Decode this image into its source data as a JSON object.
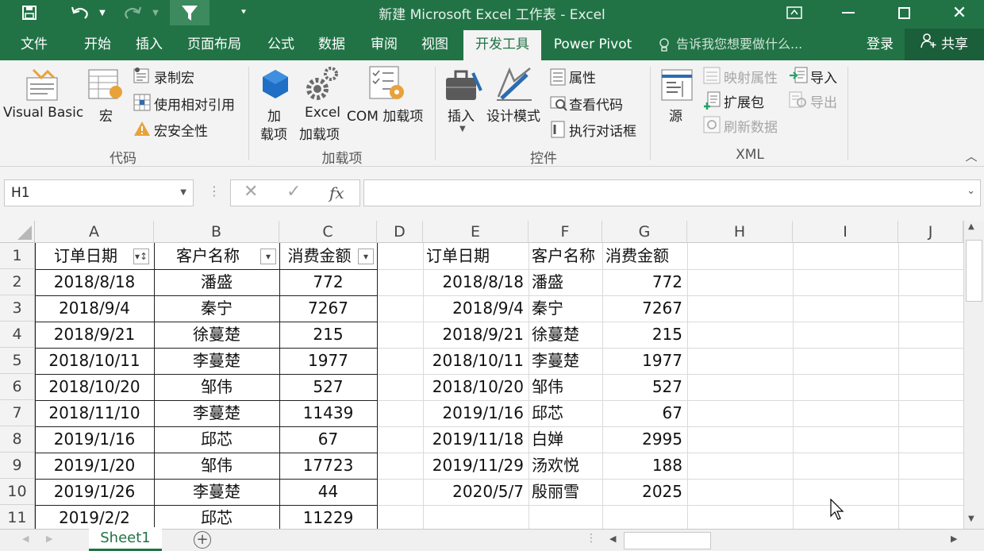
{
  "window": {
    "title": "新建 Microsoft Excel 工作表 - Excel"
  },
  "tabs": [
    "文件",
    "开始",
    "插入",
    "页面布局",
    "公式",
    "数据",
    "审阅",
    "视图",
    "开发工具",
    "Power Pivot"
  ],
  "active_tab": "开发工具",
  "tell_me": "告诉我您想要做什么...",
  "login": "登录",
  "share": "共享",
  "ribbon": {
    "code": {
      "visual_basic": "Visual Basic",
      "macros": "宏",
      "record_macro": "录制宏",
      "relative_ref": "使用相对引用",
      "macro_security": "宏安全性",
      "group": "代码"
    },
    "addins": {
      "addins_line1": "加",
      "addins_line2": "载项",
      "excel_line1": "Excel",
      "excel_line2": "加载项",
      "com": "COM 加载项",
      "group": "加载项"
    },
    "controls": {
      "insert": "插入",
      "design_mode": "设计模式",
      "properties": "属性",
      "view_code": "查看代码",
      "run_dialog": "执行对话框",
      "group": "控件"
    },
    "xml": {
      "source": "源",
      "map_props": "映射属性",
      "expansion": "扩展包",
      "refresh": "刷新数据",
      "import": "导入",
      "export": "导出",
      "group": "XML"
    }
  },
  "namebox": "H1",
  "fx": "fx",
  "columns": [
    "A",
    "B",
    "C",
    "D",
    "E",
    "F",
    "G",
    "H",
    "I",
    "J"
  ],
  "rows": [
    "1",
    "2",
    "3",
    "4",
    "5",
    "6",
    "7",
    "8",
    "9",
    "10",
    "11"
  ],
  "table1": {
    "headers": [
      "订单日期",
      "客户名称",
      "消费金额"
    ],
    "rows": [
      [
        "2018/8/18",
        "潘盛",
        "772"
      ],
      [
        "2018/9/4",
        "秦宁",
        "7267"
      ],
      [
        "2018/9/21",
        "徐蔓楚",
        "215"
      ],
      [
        "2018/10/11",
        "李蔓楚",
        "1977"
      ],
      [
        "2018/10/20",
        "邹伟",
        "527"
      ],
      [
        "2018/11/10",
        "李蔓楚",
        "11439"
      ],
      [
        "2019/1/16",
        "邱芯",
        "67"
      ],
      [
        "2019/1/20",
        "邹伟",
        "17723"
      ],
      [
        "2019/1/26",
        "李蔓楚",
        "44"
      ],
      [
        "2019/2/2",
        "邱芯",
        "11229"
      ]
    ]
  },
  "table2": {
    "headers": [
      "订单日期",
      "客户名称",
      "消费金额"
    ],
    "rows": [
      [
        "2018/8/18",
        "潘盛",
        "772"
      ],
      [
        "2018/9/4",
        "秦宁",
        "7267"
      ],
      [
        "2018/9/21",
        "徐蔓楚",
        "215"
      ],
      [
        "2018/10/11",
        "李蔓楚",
        "1977"
      ],
      [
        "2018/10/20",
        "邹伟",
        "527"
      ],
      [
        "2019/1/16",
        "邱芯",
        "67"
      ],
      [
        "2019/11/18",
        "白婵",
        "2995"
      ],
      [
        "2019/11/29",
        "汤欢悦",
        "188"
      ],
      [
        "2020/5/7",
        "殷丽雪",
        "2025"
      ]
    ]
  },
  "sheet_tab": "Sheet1",
  "colors": {
    "accent": "#217346"
  }
}
